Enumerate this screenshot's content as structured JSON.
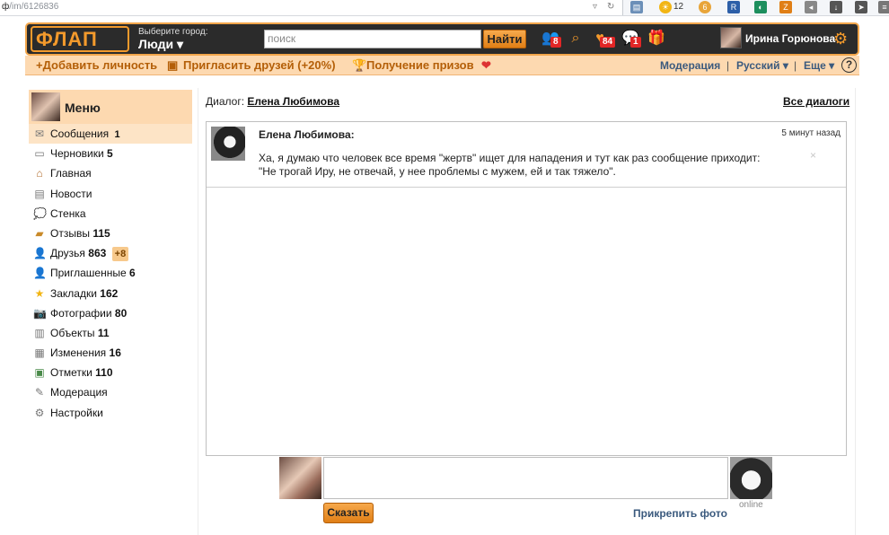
{
  "browser": {
    "url_host": "ф",
    "url_path": "/im/6126836",
    "weather_temp": "12"
  },
  "header": {
    "logo": "ФЛАП",
    "city_hint": "Выберите город:",
    "city_value": "Люди ▾",
    "search_placeholder": "поиск",
    "search_button": "Найти",
    "badges": {
      "people": "8",
      "likes": "84",
      "chat": "1"
    },
    "user_name": "Ирина Горюнова"
  },
  "subbar": {
    "add_person": "+Добавить личность",
    "invite": "Пригласить друзей (+20%)",
    "prizes": "Получение призов",
    "moderation": "Модерация",
    "language": "Русский ▾",
    "more": "Еще ▾",
    "sep": "|"
  },
  "sidebar": {
    "title": "Меню",
    "items": [
      {
        "label": "Сообщения",
        "count": "1",
        "icon": "envelope-icon"
      },
      {
        "label": "Черновики",
        "count": "5",
        "icon": "draft-icon"
      },
      {
        "label": "Главная",
        "count": "",
        "icon": "home-icon"
      },
      {
        "label": "Новости",
        "count": "",
        "icon": "news-icon"
      },
      {
        "label": "Стенка",
        "count": "",
        "icon": "wall-icon"
      },
      {
        "label": "Отзывы",
        "count": "115",
        "icon": "reviews-icon"
      },
      {
        "label": "Друзья",
        "count": "863",
        "extra": "+8",
        "icon": "friends-icon"
      },
      {
        "label": "Приглашенные",
        "count": "6",
        "icon": "invited-icon"
      },
      {
        "label": "Закладки",
        "count": "162",
        "icon": "star-icon"
      },
      {
        "label": "Фотографии",
        "count": "80",
        "icon": "camera-icon"
      },
      {
        "label": "Объекты",
        "count": "11",
        "icon": "building-icon"
      },
      {
        "label": "Изменения",
        "count": "16",
        "icon": "changes-icon"
      },
      {
        "label": "Отметки",
        "count": "110",
        "icon": "marks-icon"
      },
      {
        "label": "Модерация",
        "count": "",
        "icon": "moderation-icon"
      },
      {
        "label": "Настройки",
        "count": "",
        "icon": "settings-icon"
      }
    ]
  },
  "dialog": {
    "label": "Диалог:",
    "partner": "Елена Любимова",
    "all_dialogs": "Все диалоги"
  },
  "message": {
    "author": "Елена Любимова:",
    "time": "5 минут назад",
    "line1": "Ха, я думаю что человек все время \"жертв\" ищет для нападения и тут как раз сообщение приходит:",
    "line2": "\"Не трогай Иру, не отвечай, у нее проблемы с мужем, ей и так тяжело\".",
    "close": "×"
  },
  "compose": {
    "input_value": "",
    "send_label": "Сказать",
    "attach_label": "Прикрепить фото",
    "online": "online"
  }
}
